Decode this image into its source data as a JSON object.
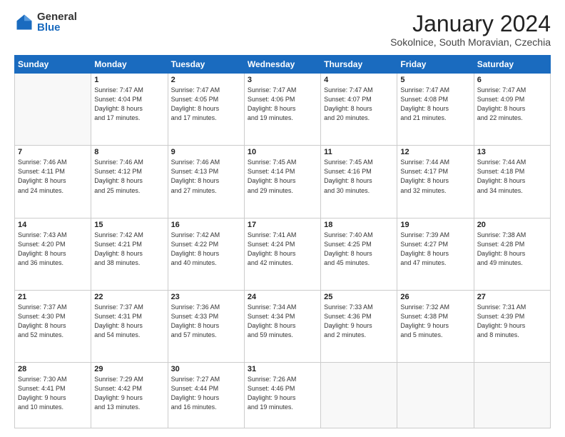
{
  "logo": {
    "general": "General",
    "blue": "Blue"
  },
  "title": "January 2024",
  "location": "Sokolnice, South Moravian, Czechia",
  "weekdays": [
    "Sunday",
    "Monday",
    "Tuesday",
    "Wednesday",
    "Thursday",
    "Friday",
    "Saturday"
  ],
  "weeks": [
    [
      {
        "day": "",
        "info": ""
      },
      {
        "day": "1",
        "info": "Sunrise: 7:47 AM\nSunset: 4:04 PM\nDaylight: 8 hours\nand 17 minutes."
      },
      {
        "day": "2",
        "info": "Sunrise: 7:47 AM\nSunset: 4:05 PM\nDaylight: 8 hours\nand 17 minutes."
      },
      {
        "day": "3",
        "info": "Sunrise: 7:47 AM\nSunset: 4:06 PM\nDaylight: 8 hours\nand 19 minutes."
      },
      {
        "day": "4",
        "info": "Sunrise: 7:47 AM\nSunset: 4:07 PM\nDaylight: 8 hours\nand 20 minutes."
      },
      {
        "day": "5",
        "info": "Sunrise: 7:47 AM\nSunset: 4:08 PM\nDaylight: 8 hours\nand 21 minutes."
      },
      {
        "day": "6",
        "info": "Sunrise: 7:47 AM\nSunset: 4:09 PM\nDaylight: 8 hours\nand 22 minutes."
      }
    ],
    [
      {
        "day": "7",
        "info": "Sunrise: 7:46 AM\nSunset: 4:11 PM\nDaylight: 8 hours\nand 24 minutes."
      },
      {
        "day": "8",
        "info": "Sunrise: 7:46 AM\nSunset: 4:12 PM\nDaylight: 8 hours\nand 25 minutes."
      },
      {
        "day": "9",
        "info": "Sunrise: 7:46 AM\nSunset: 4:13 PM\nDaylight: 8 hours\nand 27 minutes."
      },
      {
        "day": "10",
        "info": "Sunrise: 7:45 AM\nSunset: 4:14 PM\nDaylight: 8 hours\nand 29 minutes."
      },
      {
        "day": "11",
        "info": "Sunrise: 7:45 AM\nSunset: 4:16 PM\nDaylight: 8 hours\nand 30 minutes."
      },
      {
        "day": "12",
        "info": "Sunrise: 7:44 AM\nSunset: 4:17 PM\nDaylight: 8 hours\nand 32 minutes."
      },
      {
        "day": "13",
        "info": "Sunrise: 7:44 AM\nSunset: 4:18 PM\nDaylight: 8 hours\nand 34 minutes."
      }
    ],
    [
      {
        "day": "14",
        "info": "Sunrise: 7:43 AM\nSunset: 4:20 PM\nDaylight: 8 hours\nand 36 minutes."
      },
      {
        "day": "15",
        "info": "Sunrise: 7:42 AM\nSunset: 4:21 PM\nDaylight: 8 hours\nand 38 minutes."
      },
      {
        "day": "16",
        "info": "Sunrise: 7:42 AM\nSunset: 4:22 PM\nDaylight: 8 hours\nand 40 minutes."
      },
      {
        "day": "17",
        "info": "Sunrise: 7:41 AM\nSunset: 4:24 PM\nDaylight: 8 hours\nand 42 minutes."
      },
      {
        "day": "18",
        "info": "Sunrise: 7:40 AM\nSunset: 4:25 PM\nDaylight: 8 hours\nand 45 minutes."
      },
      {
        "day": "19",
        "info": "Sunrise: 7:39 AM\nSunset: 4:27 PM\nDaylight: 8 hours\nand 47 minutes."
      },
      {
        "day": "20",
        "info": "Sunrise: 7:38 AM\nSunset: 4:28 PM\nDaylight: 8 hours\nand 49 minutes."
      }
    ],
    [
      {
        "day": "21",
        "info": "Sunrise: 7:37 AM\nSunset: 4:30 PM\nDaylight: 8 hours\nand 52 minutes."
      },
      {
        "day": "22",
        "info": "Sunrise: 7:37 AM\nSunset: 4:31 PM\nDaylight: 8 hours\nand 54 minutes."
      },
      {
        "day": "23",
        "info": "Sunrise: 7:36 AM\nSunset: 4:33 PM\nDaylight: 8 hours\nand 57 minutes."
      },
      {
        "day": "24",
        "info": "Sunrise: 7:34 AM\nSunset: 4:34 PM\nDaylight: 8 hours\nand 59 minutes."
      },
      {
        "day": "25",
        "info": "Sunrise: 7:33 AM\nSunset: 4:36 PM\nDaylight: 9 hours\nand 2 minutes."
      },
      {
        "day": "26",
        "info": "Sunrise: 7:32 AM\nSunset: 4:38 PM\nDaylight: 9 hours\nand 5 minutes."
      },
      {
        "day": "27",
        "info": "Sunrise: 7:31 AM\nSunset: 4:39 PM\nDaylight: 9 hours\nand 8 minutes."
      }
    ],
    [
      {
        "day": "28",
        "info": "Sunrise: 7:30 AM\nSunset: 4:41 PM\nDaylight: 9 hours\nand 10 minutes."
      },
      {
        "day": "29",
        "info": "Sunrise: 7:29 AM\nSunset: 4:42 PM\nDaylight: 9 hours\nand 13 minutes."
      },
      {
        "day": "30",
        "info": "Sunrise: 7:27 AM\nSunset: 4:44 PM\nDaylight: 9 hours\nand 16 minutes."
      },
      {
        "day": "31",
        "info": "Sunrise: 7:26 AM\nSunset: 4:46 PM\nDaylight: 9 hours\nand 19 minutes."
      },
      {
        "day": "",
        "info": ""
      },
      {
        "day": "",
        "info": ""
      },
      {
        "day": "",
        "info": ""
      }
    ]
  ]
}
